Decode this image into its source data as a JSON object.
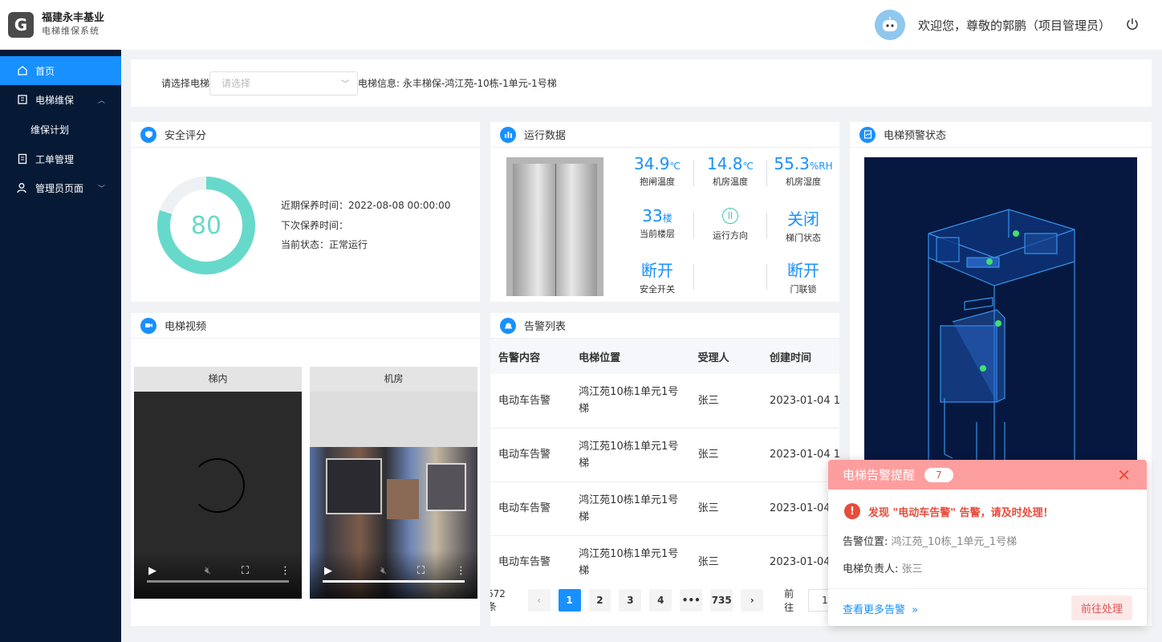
{
  "brand": {
    "mark": "G",
    "name": "福建永丰基业",
    "sub": "电梯维保系统"
  },
  "sidebar": {
    "items": [
      {
        "label": "首页",
        "icon": "home-icon",
        "active": true
      },
      {
        "label": "电梯维保",
        "icon": "book-icon",
        "arrow": "up"
      },
      {
        "label": "维保计划",
        "sub": true
      },
      {
        "label": "工单管理",
        "icon": "clipboard-icon"
      },
      {
        "label": "管理员页面",
        "icon": "user-gear-icon",
        "arrow": "down"
      }
    ]
  },
  "header": {
    "welcome": "欢迎您，尊敬的郭鹏（项目管理员）",
    "avatar_icon": "robot-avatar-icon",
    "logout_icon": "power-icon"
  },
  "filter": {
    "label": "请选择电梯",
    "placeholder": "请选择",
    "info": "电梯信息: 永丰梯保-鸿江苑-10栋-1单元-1号梯"
  },
  "safety": {
    "title": "安全评分",
    "score": "80",
    "score_fraction": 0.8,
    "last_maintenance": "近期保养时间：2022-08-08 00:00:00",
    "next_maintenance": "下次保养时间：",
    "status": "当前状态：正常运行"
  },
  "running": {
    "title": "运行数据",
    "metrics": {
      "brake_temp": {
        "value": "34.9",
        "unit": "℃",
        "label": "抱闸温度"
      },
      "room_temp": {
        "value": "14.8",
        "unit": "℃",
        "label": "机房温度"
      },
      "room_humidity": {
        "value": "55.3",
        "unit": "%RH",
        "label": "机房湿度"
      },
      "floor": {
        "value": "33",
        "unit": "楼",
        "label": "当前楼层"
      },
      "direction": {
        "label": "运行方向"
      },
      "door": {
        "value": "关闭",
        "label": "梯门状态"
      },
      "safety_switch": {
        "value": "断开",
        "label": "安全开关"
      },
      "door_lock": {
        "value": "断开",
        "label": "门联锁"
      }
    }
  },
  "warning_status": {
    "title": "电梯预警状态"
  },
  "video": {
    "title": "电梯视频",
    "cams": [
      {
        "label": "梯内"
      },
      {
        "label": "机房"
      }
    ]
  },
  "alarms": {
    "title": "告警列表",
    "columns": [
      "告警内容",
      "电梯位置",
      "受理人",
      "创建时间"
    ],
    "rows": [
      {
        "content": "电动车告警",
        "loc1": "鸿江苑10栋1单元1号",
        "loc2": "梯",
        "person": "张三",
        "time": "2023-01-04 1"
      },
      {
        "content": "电动车告警",
        "loc1": "鸿江苑10栋1单元1号",
        "loc2": "梯",
        "person": "张三",
        "time": "2023-01-04 1"
      },
      {
        "content": "电动车告警",
        "loc1": "鸿江苑10栋1单元1号",
        "loc2": "梯",
        "person": "张三",
        "time": "2023-01-04"
      },
      {
        "content": "电动车告警",
        "loc1": "鸿江苑10栋1单元1号",
        "loc2": "梯",
        "person": "张三",
        "time": "2023-01-04"
      }
    ],
    "pager": {
      "total": "672 条",
      "pages": [
        "1",
        "2",
        "3",
        "4",
        "•••",
        "735"
      ],
      "goto": "前往",
      "goto_value": "1"
    }
  },
  "notify": {
    "title": "电梯告警提醒",
    "count": "7",
    "warning": "发现 \"电动车告警\" 告警，请及时处理！",
    "location_label": "告警位置:",
    "location": "鸿江苑_10栋_1单元_1号梯",
    "owner_label": "电梯负责人:",
    "owner": "张三",
    "more": "查看更多告警",
    "go": "前往处理"
  }
}
